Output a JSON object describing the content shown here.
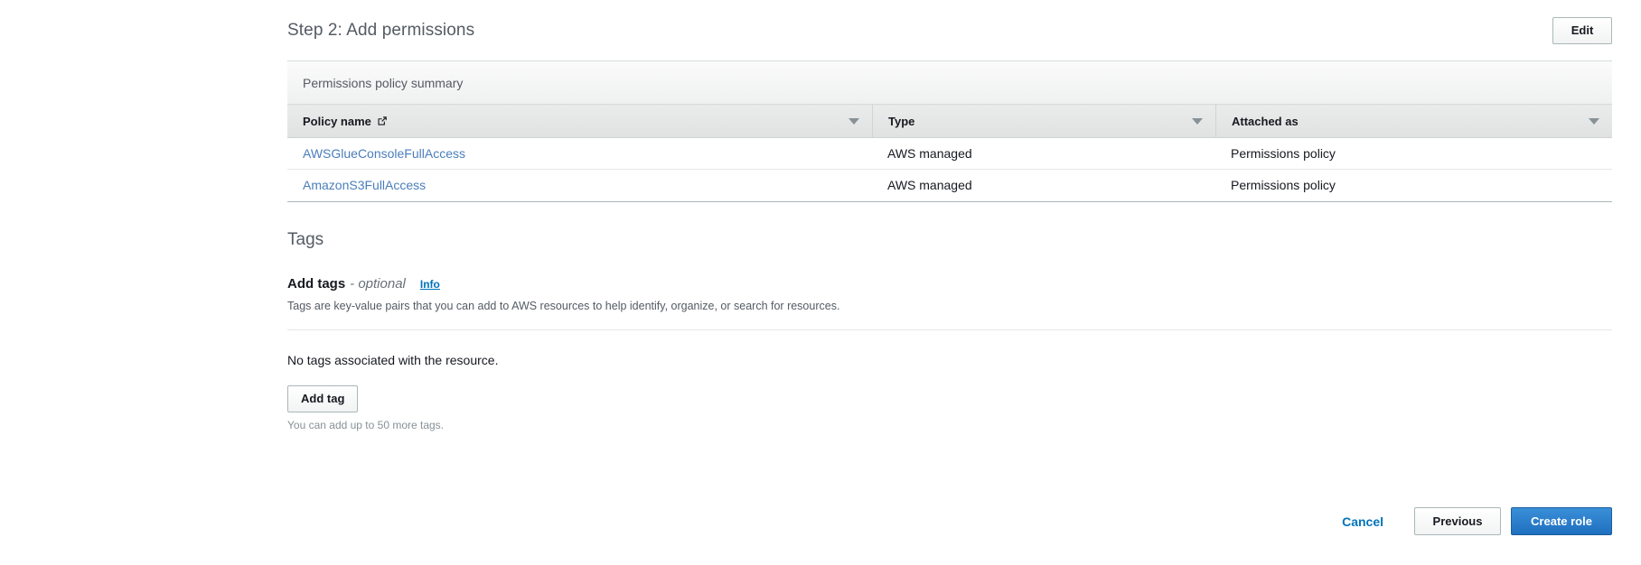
{
  "step": {
    "title": "Step 2: Add permissions",
    "edit_label": "Edit"
  },
  "permissions_table": {
    "caption": "Permissions policy summary",
    "columns": [
      {
        "label": "Policy name",
        "icon": "external-link-icon",
        "sortable": true
      },
      {
        "label": "Type",
        "sortable": true
      },
      {
        "label": "Attached as",
        "sortable": true
      }
    ],
    "rows": [
      {
        "policy_name": "AWSGlueConsoleFullAccess",
        "type": "AWS managed",
        "attached_as": "Permissions policy"
      },
      {
        "policy_name": "AmazonS3FullAccess",
        "type": "AWS managed",
        "attached_as": "Permissions policy"
      }
    ]
  },
  "tags": {
    "section_heading": "Tags",
    "add_tags_label": "Add tags",
    "optional_label": "- optional",
    "info_label": "Info",
    "description": "Tags are key-value pairs that you can add to AWS resources to help identify, organize, or search for resources.",
    "empty_message": "No tags associated with the resource.",
    "add_tag_button": "Add tag",
    "hint": "You can add up to 50 more tags."
  },
  "footer": {
    "cancel_label": "Cancel",
    "previous_label": "Previous",
    "create_label": "Create role"
  },
  "colors": {
    "link_blue": "#0073bb",
    "policy_link_blue": "#4a7ebb",
    "primary_button_blue": "#1f6fbf",
    "heading_gray": "#545b64",
    "border_gray": "#d5dbdb"
  }
}
